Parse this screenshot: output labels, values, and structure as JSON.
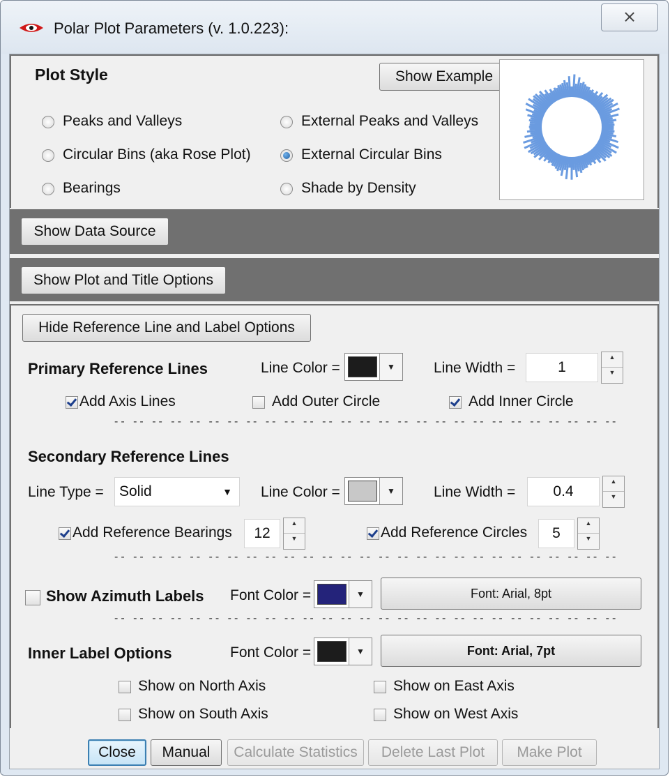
{
  "window": {
    "title": "Polar Plot Parameters (v. 1.0.223):",
    "close_glyph": "⨯"
  },
  "plot_style": {
    "heading": "Plot Style",
    "show_example_label": "Show Example",
    "options": [
      {
        "label": "Peaks and Valleys",
        "selected": false
      },
      {
        "label": "External Peaks and Valleys",
        "selected": false
      },
      {
        "label": "Circular Bins (aka Rose Plot)",
        "selected": false
      },
      {
        "label": "External Circular Bins",
        "selected": true
      },
      {
        "label": "Bearings",
        "selected": false
      },
      {
        "label": "Shade by Density",
        "selected": false
      }
    ],
    "preview_color": "#6a9be0"
  },
  "data_source": {
    "button_label": "Show Data Source"
  },
  "plot_title_options": {
    "button_label": "Show Plot and Title Options"
  },
  "reference": {
    "toggle_label": "Hide Reference Line and Label Options",
    "primary": {
      "heading": "Primary Reference Lines",
      "line_color_label": "Line Color =",
      "line_color": "#1c1c1c",
      "line_width_label": "Line Width =",
      "line_width": "1",
      "add_axis_lines": {
        "label": "Add Axis Lines",
        "checked": true
      },
      "add_outer_circle": {
        "label": "Add Outer Circle",
        "checked": false
      },
      "add_inner_circle": {
        "label": "Add Inner Circle",
        "checked": true
      }
    },
    "secondary": {
      "heading": "Secondary Reference Lines",
      "line_type_label": "Line Type =",
      "line_type": "Solid",
      "line_color_label": "Line Color =",
      "line_color": "#c8c8c8",
      "line_width_label": "Line Width =",
      "line_width": "0.4",
      "add_ref_bearings": {
        "label": "Add Reference Bearings",
        "checked": true,
        "count": "12"
      },
      "add_ref_circles": {
        "label": "Add Reference Circles",
        "checked": true,
        "count": "5"
      }
    },
    "azimuth": {
      "label": "Show Azimuth Labels",
      "checked": false,
      "font_color_label": "Font Color =",
      "font_color": "#24237a",
      "font_button": "Font: Arial, 8pt"
    },
    "inner": {
      "heading": "Inner Label Options",
      "font_color_label": "Font Color =",
      "font_color": "#1c1c1c",
      "font_button": "Font: Arial, 7pt",
      "north": {
        "label": "Show on North Axis",
        "checked": false
      },
      "east": {
        "label": "Show on East Axis",
        "checked": false
      },
      "south": {
        "label": "Show on South Axis",
        "checked": false
      },
      "west": {
        "label": "Show on West Axis",
        "checked": false
      }
    },
    "separator": "-- -- -- -- -- -- -- -- -- -- -- -- -- -- -- -- -- -- -- -- -- -- -- -- -- -- --"
  },
  "footer": {
    "close": "Close",
    "manual": "Manual",
    "calc_stats": "Calculate Statistics",
    "delete_last": "Delete Last Plot",
    "make_plot": "Make Plot"
  }
}
